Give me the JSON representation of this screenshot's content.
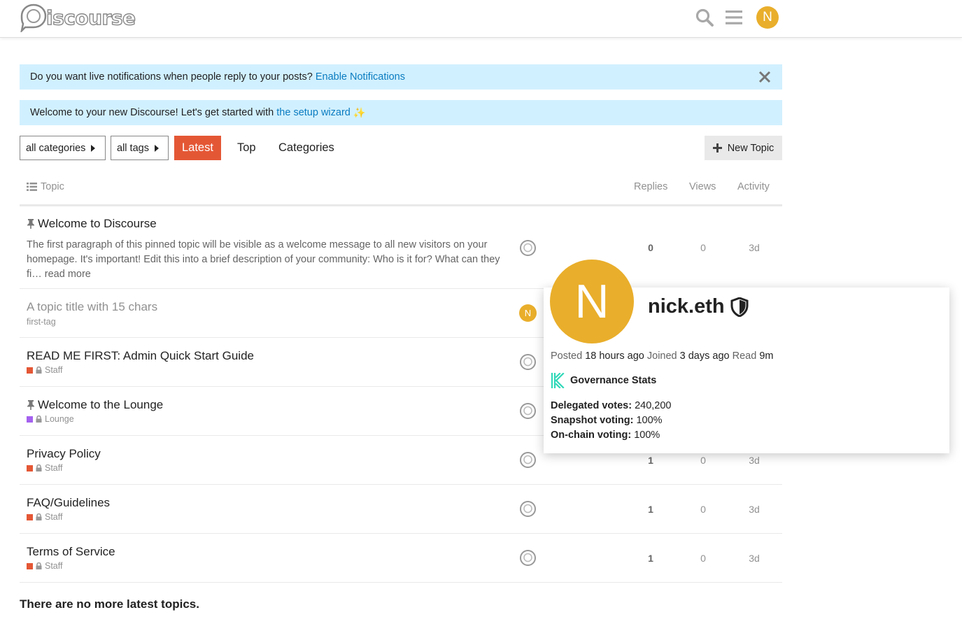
{
  "header": {
    "logo_text": "iscourse",
    "avatar_letter": "N",
    "avatar_color": "#e9ae2b"
  },
  "banners": {
    "notify_text": "Do you want live notifications when people reply to your posts? ",
    "notify_link": "Enable Notifications",
    "welcome_text": "Welcome to your new Discourse! Let's get started with ",
    "welcome_link": "the setup wizard",
    "wizard_glyph": "✨"
  },
  "nav": {
    "categories_dd": "all categories",
    "tags_dd": "all tags",
    "latest": "Latest",
    "top": "Top",
    "categories": "Categories",
    "new_topic": "New Topic"
  },
  "table": {
    "col_topic": "Topic",
    "col_replies": "Replies",
    "col_views": "Views",
    "col_activity": "Activity"
  },
  "topics": [
    {
      "title": "Welcome to Discourse",
      "pinned": true,
      "excerpt": "The first paragraph of this pinned topic will be visible as a welcome message to all new visitors on your homepage. It's important! Edit this into a brief description of your community: Who is it for? What can they fi… ",
      "read_more": "read more",
      "replies": "0",
      "views": "0",
      "activity": "3d"
    },
    {
      "title": "A topic title with 15 chars",
      "tag": "first-tag",
      "poster_letter": "N"
    },
    {
      "title": "READ ME FIRST: Admin Quick Start Guide",
      "category": "Staff",
      "category_color": "#e45735"
    },
    {
      "title": "Welcome to the Lounge",
      "pinned": true,
      "category": "Lounge",
      "category_color": "#a461ef"
    },
    {
      "title": "Privacy Policy",
      "category": "Staff",
      "category_color": "#e45735",
      "replies": "1",
      "views": "0",
      "activity": "3d"
    },
    {
      "title": "FAQ/Guidelines",
      "category": "Staff",
      "category_color": "#e45735",
      "replies": "1",
      "views": "0",
      "activity": "3d"
    },
    {
      "title": "Terms of Service",
      "category": "Staff",
      "category_color": "#e45735",
      "replies": "1",
      "views": "0",
      "activity": "3d"
    }
  ],
  "footer_message": "There are no more latest topics.",
  "user_card": {
    "avatar_letter": "N",
    "username": "nick.eth",
    "posted_label": "Posted",
    "posted_value": "18 hours ago",
    "joined_label": "Joined",
    "joined_value": "3 days ago",
    "read_label": "Read",
    "read_value": "9m",
    "gov_title": "Governance Stats",
    "stats": [
      {
        "label": "Delegated votes:",
        "value": " 240,200"
      },
      {
        "label": "Snapshot voting:",
        "value": " 100%"
      },
      {
        "label": "On-chain voting:",
        "value": " 100%"
      }
    ]
  }
}
